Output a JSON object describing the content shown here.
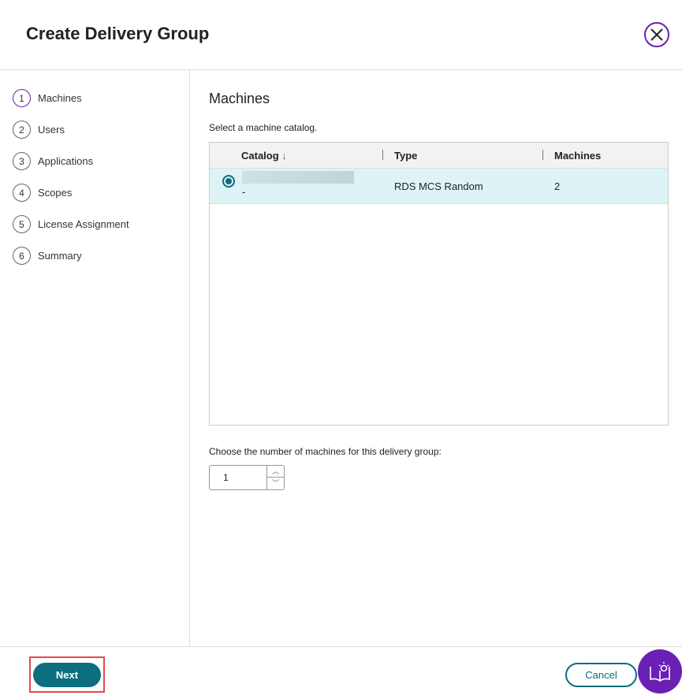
{
  "header": {
    "title": "Create Delivery Group"
  },
  "steps": [
    {
      "n": "1",
      "label": "Machines"
    },
    {
      "n": "2",
      "label": "Users"
    },
    {
      "n": "3",
      "label": "Applications"
    },
    {
      "n": "4",
      "label": "Scopes"
    },
    {
      "n": "5",
      "label": "License Assignment"
    },
    {
      "n": "6",
      "label": "Summary"
    }
  ],
  "main": {
    "heading": "Machines",
    "instruction": "Select a machine catalog.",
    "columns": [
      "Catalog",
      "Type",
      "Machines"
    ],
    "rows": [
      {
        "catalog_suffix": "-",
        "type": "RDS MCS Random",
        "machines": "2"
      }
    ],
    "choose_label": "Choose the number of machines for this delivery group:",
    "count": "1"
  },
  "footer": {
    "next": "Next",
    "cancel": "Cancel"
  },
  "colors": {
    "accent": "#0c6e7e",
    "brand": "#6a1fb5"
  }
}
